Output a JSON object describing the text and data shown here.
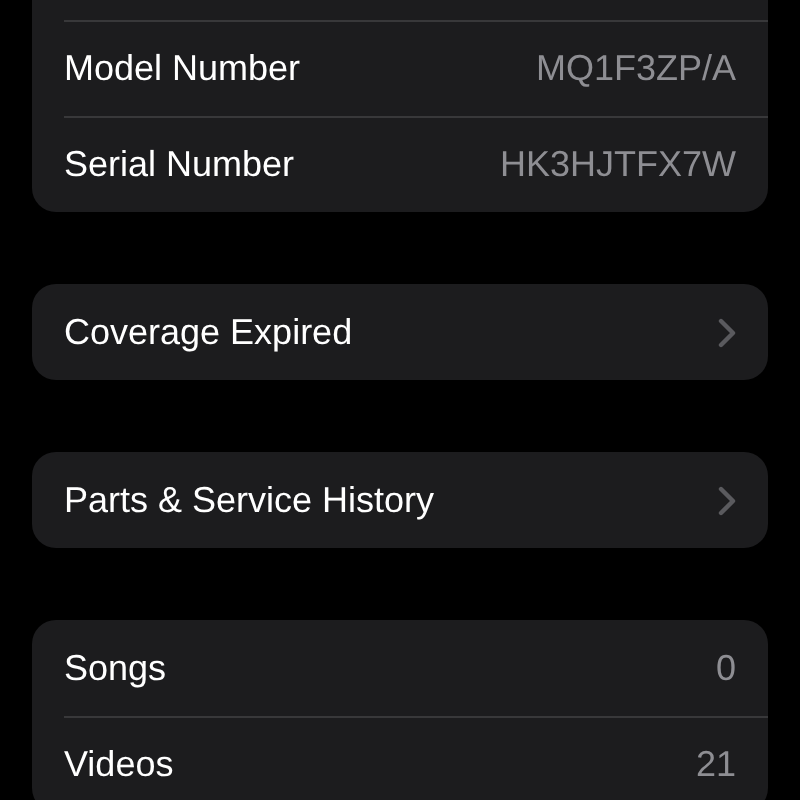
{
  "groups": [
    {
      "rows": [
        {
          "label": "Model Number",
          "value": "MQ1F3ZP/A"
        },
        {
          "label": "Serial Number",
          "value": "HK3HJTFX7W"
        }
      ]
    },
    {
      "rows": [
        {
          "label": "Coverage Expired",
          "disclosure": true
        }
      ]
    },
    {
      "rows": [
        {
          "label": "Parts & Service History",
          "disclosure": true
        }
      ]
    },
    {
      "rows": [
        {
          "label": "Songs",
          "value": "0"
        },
        {
          "label": "Videos",
          "value": "21"
        }
      ]
    }
  ]
}
